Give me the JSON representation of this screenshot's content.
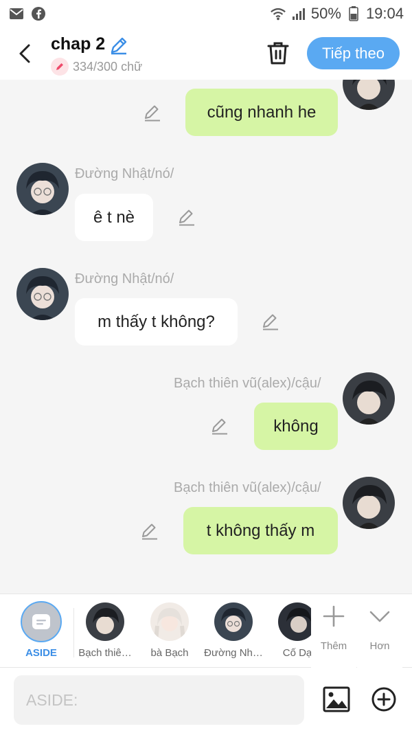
{
  "status_bar": {
    "battery": "50%",
    "time": "19:04",
    "icons": [
      "mail-icon",
      "facebook-icon",
      "wifi-icon",
      "signal-icon",
      "battery-icon"
    ]
  },
  "header": {
    "title": "chap 2",
    "word_count": "334/300 chữ",
    "next_label": "Tiếp theo"
  },
  "messages": [
    {
      "side": "right",
      "sender": "",
      "text": "cũng nhanh he"
    },
    {
      "side": "left",
      "sender": "Đường Nhật/nó/",
      "text": "ê t nè"
    },
    {
      "side": "left",
      "sender": "Đường Nhật/nó/",
      "text": "m thấy t không?"
    },
    {
      "side": "right",
      "sender": "Bạch thiên vũ(alex)/cậu/",
      "text": "không"
    },
    {
      "side": "right",
      "sender": "Bạch thiên vũ(alex)/cậu/",
      "text": "t không thấy m"
    }
  ],
  "characters": {
    "aside_label": "ASIDE",
    "items": [
      {
        "label": "Bạch thiê…"
      },
      {
        "label": "bà Bạch"
      },
      {
        "label": "Đường Nh…"
      },
      {
        "label": "Cố Dạ"
      }
    ],
    "add_label": "Thêm",
    "more_label": "Hơn"
  },
  "composer": {
    "placeholder": "ASIDE:"
  },
  "colors": {
    "accent": "#5aa9f2",
    "bubble_right": "#d6f5a5",
    "bubble_left": "#ffffff",
    "background": "#f5f5f5"
  }
}
